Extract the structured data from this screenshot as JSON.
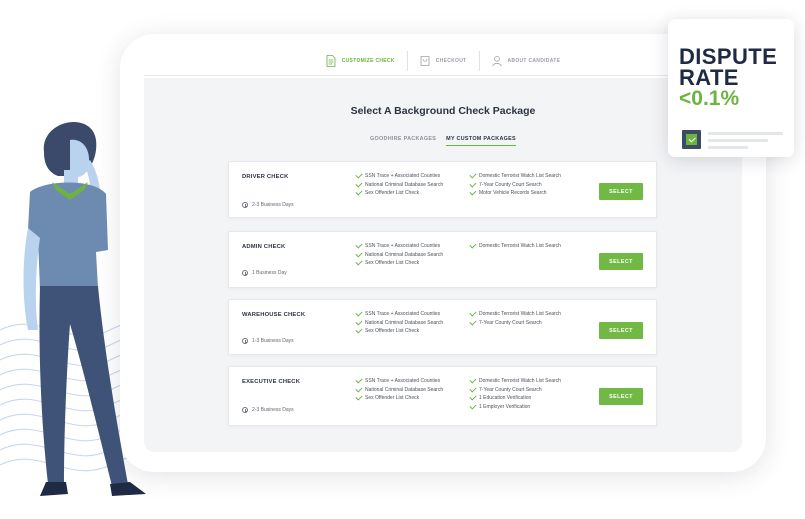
{
  "nav": {
    "steps": [
      {
        "label": "CUSTOMIZE CHECK",
        "icon": "document-icon",
        "active": true
      },
      {
        "label": "CHECKOUT",
        "icon": "cart-icon",
        "active": false
      },
      {
        "label": "ABOUT CANDIDATE",
        "icon": "user-icon",
        "active": false
      }
    ]
  },
  "page": {
    "title": "Select A Background Check Package",
    "tabs": [
      {
        "label": "GOODHIRE PACKAGES",
        "active": false
      },
      {
        "label": "MY CUSTOM PACKAGES",
        "active": true
      }
    ]
  },
  "packages": [
    {
      "name": "DRIVER CHECK",
      "days": "2-3 Business Days",
      "features_left": [
        "SSN Trace + Associated Counties",
        "National Criminal Database Search",
        "Sex Offender List Check"
      ],
      "features_right": [
        "Domestic Terrorist Watch List Search",
        "7-Year County Court Search",
        "Motor Vehicle Records Search"
      ],
      "button": "SELECT"
    },
    {
      "name": "ADMIN CHECK",
      "days": "1 Business Day",
      "features_left": [
        "SSN Trace + Associated Counties",
        "National Criminal Database Search",
        "Sex Offender List Check"
      ],
      "features_right": [
        "Domestic Terrorist Watch List Search"
      ],
      "button": "SELECT"
    },
    {
      "name": "WAREHOUSE CHECK",
      "days": "1-3 Business Days",
      "features_left": [
        "SSN Trace + Associated Counties",
        "National Criminal Database Search",
        "Sex Offender List Check"
      ],
      "features_right": [
        "Domestic Terrorist Watch List Search",
        "7-Year County Court Search"
      ],
      "button": "SELECT"
    },
    {
      "name": "EXECUTIVE CHECK",
      "days": "2-3 Business Days",
      "features_left": [
        "SSN Trace + Associated Counties",
        "National Criminal Database Search",
        "Sex Offender List Check"
      ],
      "features_right": [
        "Domestic Terrorist Watch List Search",
        "7-Year County Court Search",
        "1 Education Verification",
        "1 Employer Verification"
      ],
      "button": "SELECT"
    }
  ],
  "stat": {
    "line1": "DISPUTE",
    "line2": "RATE",
    "value": "<0.1%",
    "icon": "checkbox-icon"
  },
  "colors": {
    "accent": "#6db33f",
    "button": "#72b844",
    "navy": "#1f2a44",
    "screen_bg": "#f3f4f6"
  }
}
